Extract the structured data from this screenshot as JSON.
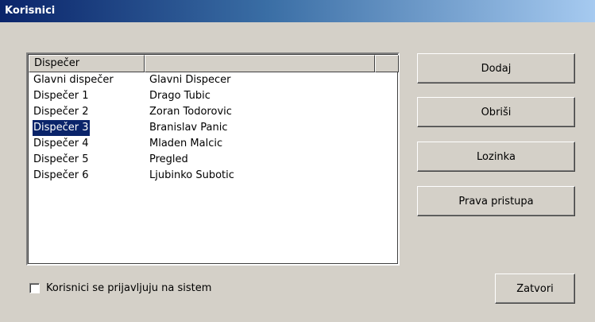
{
  "window": {
    "title": "Korisnici"
  },
  "list": {
    "columns": [
      "Dispečer",
      "",
      ""
    ],
    "rows": [
      {
        "col1": "Glavni dispečer",
        "col2": "Glavni Dispecer"
      },
      {
        "col1": "Dispečer 1",
        "col2": "Drago Tubic"
      },
      {
        "col1": "Dispečer 2",
        "col2": "Zoran Todorovic"
      },
      {
        "col1": "Dispečer 3",
        "col2": "Branislav Panic"
      },
      {
        "col1": "Dispečer 4",
        "col2": "Mladen Malcic"
      },
      {
        "col1": "Dispečer 5",
        "col2": "Pregled"
      },
      {
        "col1": "Dispečer 6",
        "col2": "Ljubinko Subotic"
      }
    ],
    "selected_row": "Dispečer 3"
  },
  "buttons": {
    "add": "Dodaj",
    "delete": "Obriši",
    "password": "Lozinka",
    "permissions": "Prava pristupa",
    "close": "Zatvori"
  },
  "checkbox": {
    "label": "Korisnici se prijavljuju na sistem",
    "checked": false
  },
  "colors": {
    "face": "#d4d0c8",
    "selection": "#0a246a",
    "title_start": "#0a246a",
    "title_end": "#a6caf0"
  }
}
